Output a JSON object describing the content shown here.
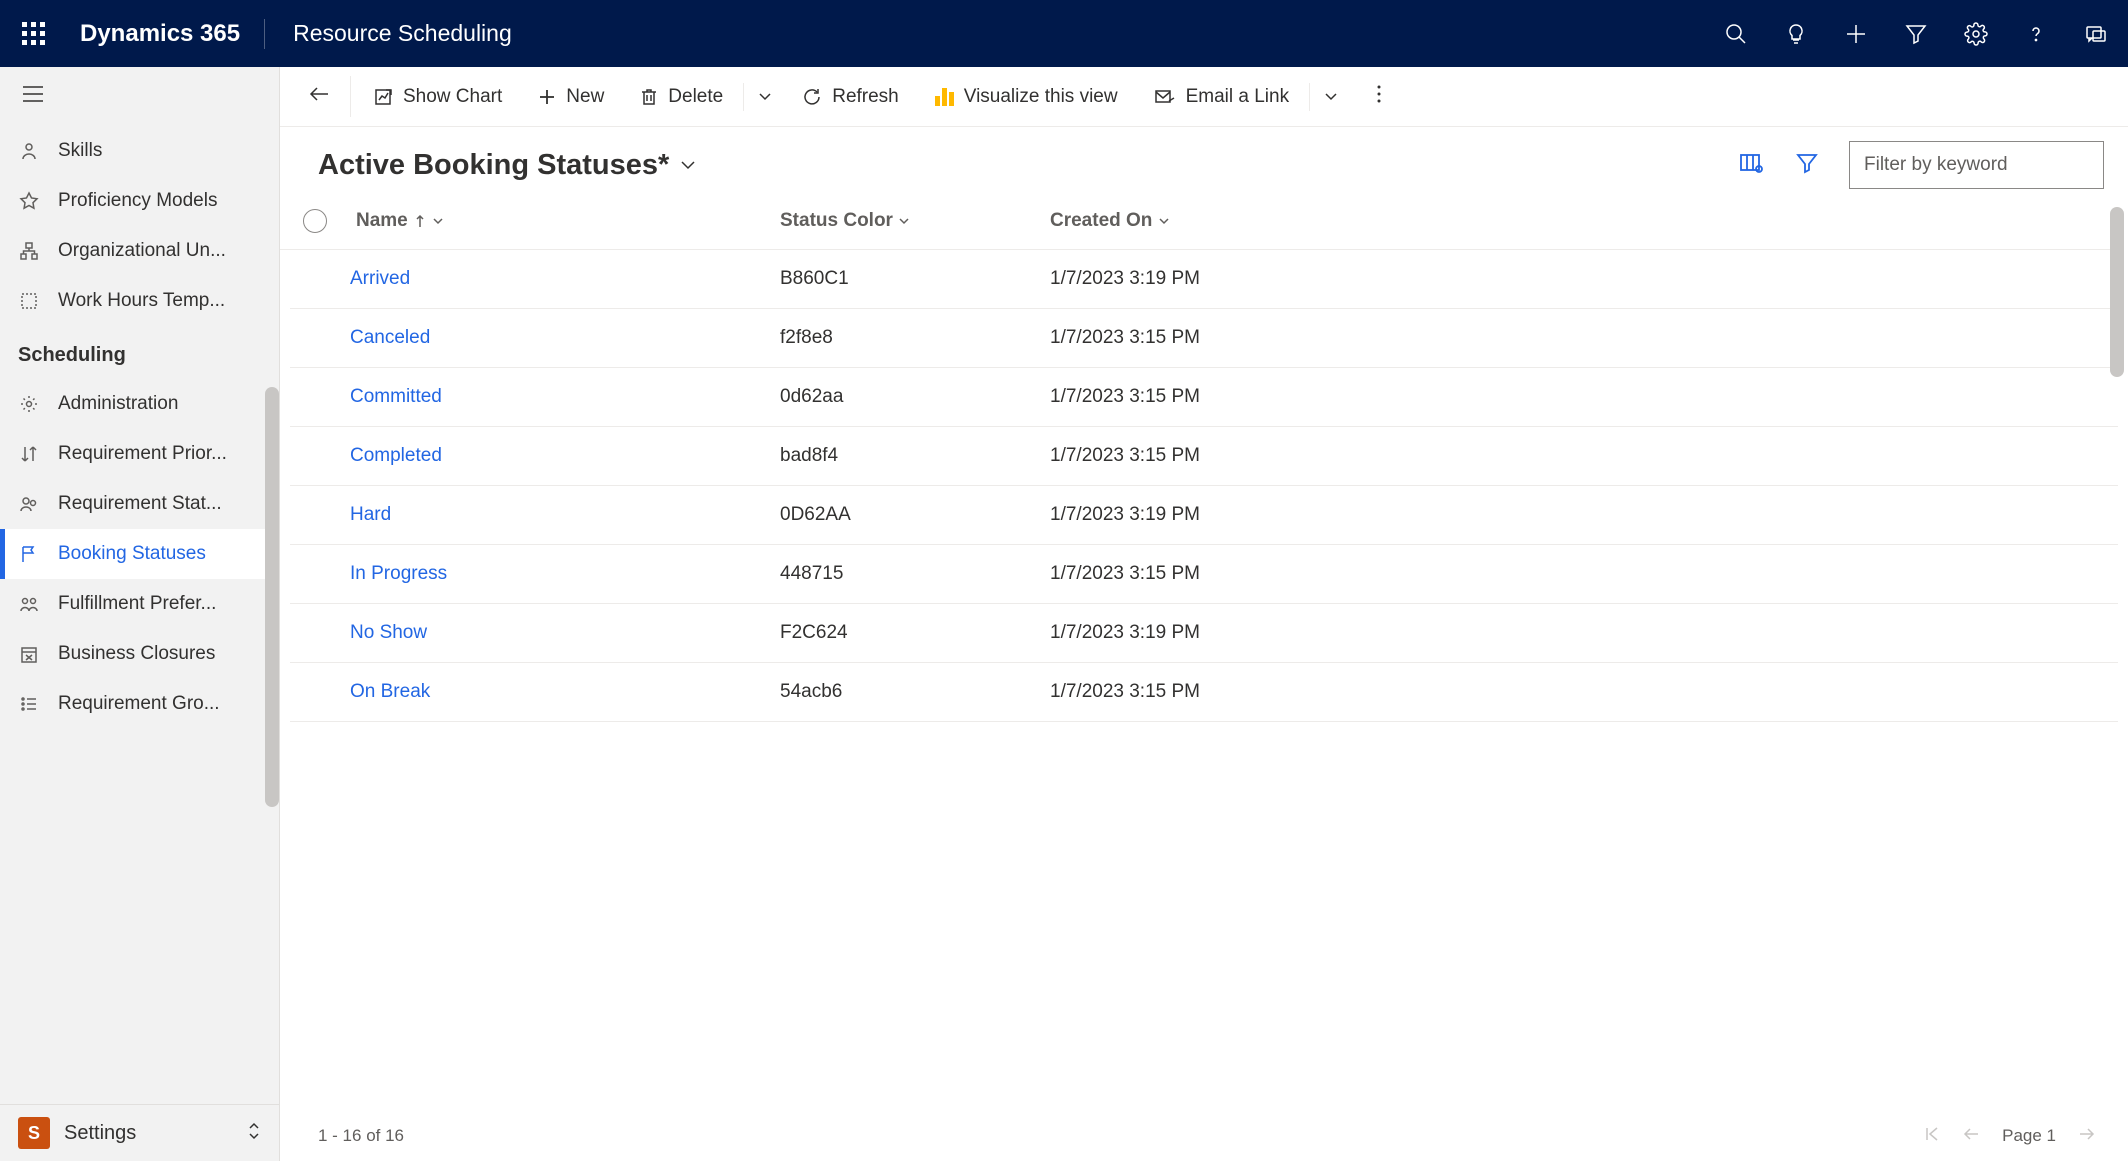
{
  "header": {
    "brand": "Dynamics 365",
    "app_name": "Resource Scheduling"
  },
  "sidebar": {
    "items": [
      {
        "label": "Skills"
      },
      {
        "label": "Proficiency Models"
      },
      {
        "label": "Organizational Un..."
      },
      {
        "label": "Work Hours Temp..."
      }
    ],
    "section_header": "Scheduling",
    "section_items": [
      {
        "label": "Administration"
      },
      {
        "label": "Requirement Prior..."
      },
      {
        "label": "Requirement Stat..."
      },
      {
        "label": "Booking Statuses"
      },
      {
        "label": "Fulfillment Prefer..."
      },
      {
        "label": "Business Closures"
      },
      {
        "label": "Requirement Gro..."
      }
    ],
    "footer": {
      "tile": "S",
      "label": "Settings"
    }
  },
  "commands": {
    "show_chart": "Show Chart",
    "new": "New",
    "delete": "Delete",
    "refresh": "Refresh",
    "visualize": "Visualize this view",
    "email_link": "Email a Link"
  },
  "view": {
    "title": "Active Booking Statuses*",
    "filter_placeholder": "Filter by keyword"
  },
  "columns": {
    "name": "Name",
    "status_color": "Status Color",
    "created_on": "Created On"
  },
  "rows": [
    {
      "name": "Arrived",
      "color": "B860C1",
      "created": "1/7/2023 3:19 PM"
    },
    {
      "name": "Canceled",
      "color": "f2f8e8",
      "created": "1/7/2023 3:15 PM"
    },
    {
      "name": "Committed",
      "color": "0d62aa",
      "created": "1/7/2023 3:15 PM"
    },
    {
      "name": "Completed",
      "color": "bad8f4",
      "created": "1/7/2023 3:15 PM"
    },
    {
      "name": "Hard",
      "color": "0D62AA",
      "created": "1/7/2023 3:19 PM"
    },
    {
      "name": "In Progress",
      "color": "448715",
      "created": "1/7/2023 3:15 PM"
    },
    {
      "name": "No Show",
      "color": "F2C624",
      "created": "1/7/2023 3:19 PM"
    },
    {
      "name": "On Break",
      "color": "54acb6",
      "created": "1/7/2023 3:15 PM"
    }
  ],
  "pager": {
    "summary": "1 - 16 of 16",
    "page_label": "Page 1"
  }
}
